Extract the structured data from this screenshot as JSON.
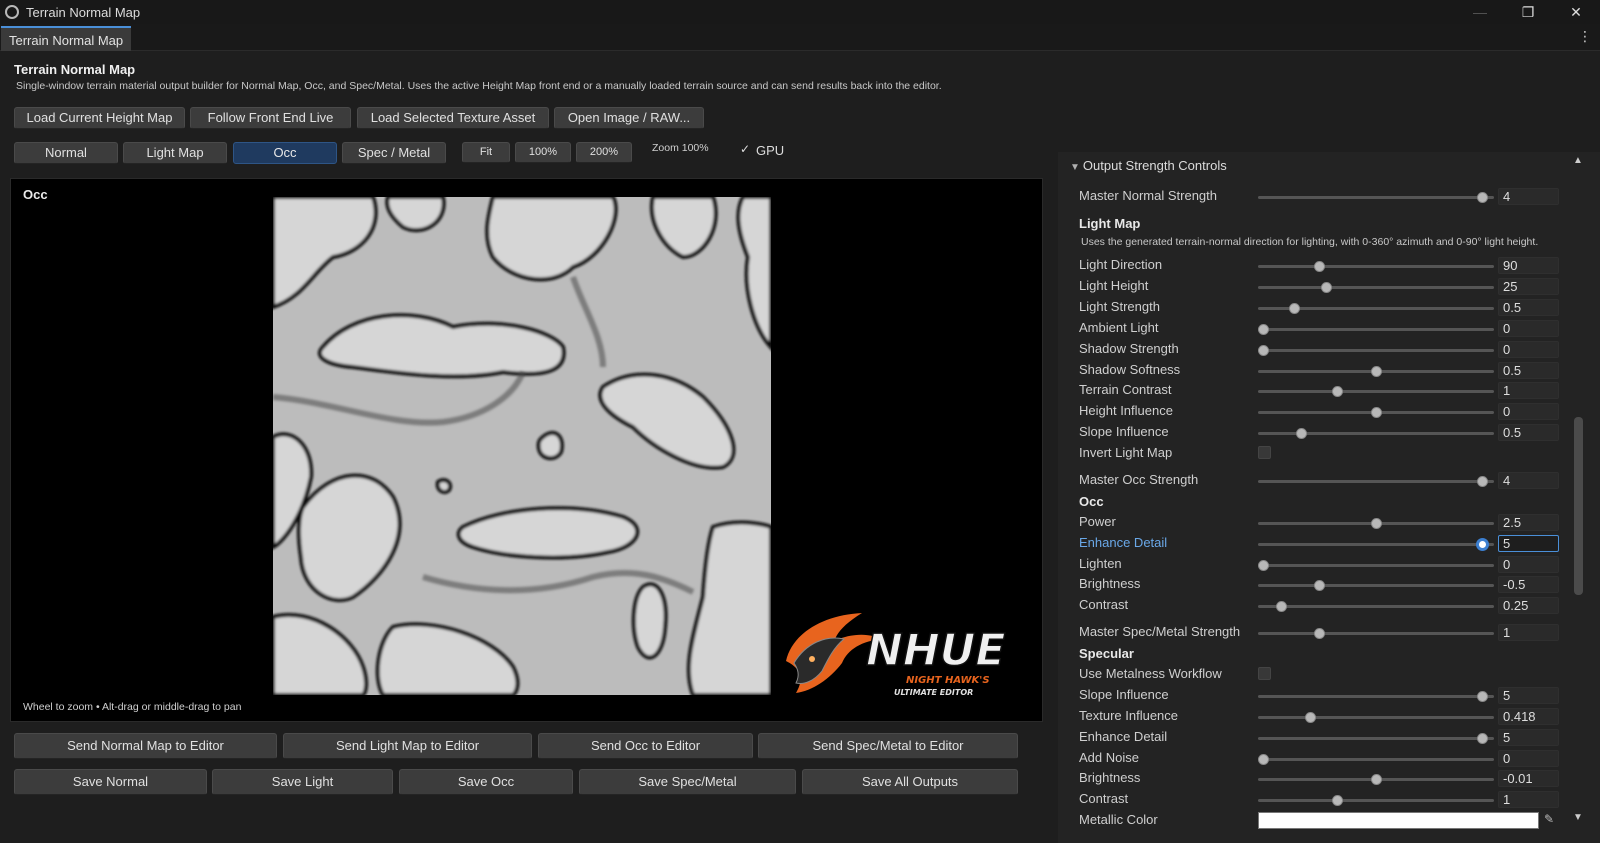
{
  "window": {
    "title": "Terrain Normal Map",
    "minimize": "—",
    "restore": "❐",
    "close": "✕",
    "icon": "gear-icon"
  },
  "tab": {
    "label": "Terrain Normal Map",
    "menu": "⋮"
  },
  "header": {
    "title": "Terrain Normal Map",
    "description": "Single-window terrain material output builder for Normal Map, Occ, and Spec/Metal. Uses the active Height Map front end or a manually loaded terrain source and can send results back into the editor."
  },
  "load_buttons": [
    "Load Current Height Map",
    "Follow Front End Live",
    "Load Selected Texture Asset",
    "Open Image / RAW..."
  ],
  "mode_buttons": [
    "Normal",
    "Light Map",
    "Occ",
    "Spec / Metal"
  ],
  "active_mode": "Occ",
  "zoom_buttons": [
    "Fit",
    "100%",
    "200%"
  ],
  "zoom_label": "Zoom 100%",
  "gpu": {
    "label": "GPU",
    "checked": true,
    "mark": "✓"
  },
  "viewport": {
    "label": "Occ",
    "hint": "Wheel to zoom • Alt-drag or middle-drag to pan"
  },
  "logo": {
    "brand": "NHUE",
    "line1": "NIGHT HAWK'S",
    "line2": "ULTIMATE EDITOR",
    "accent": "#e8641e"
  },
  "send_buttons": [
    "Send Normal Map to Editor",
    "Send Light Map to Editor",
    "Send Occ to Editor",
    "Send Spec/Metal to Editor"
  ],
  "save_buttons": [
    "Save Normal",
    "Save Light",
    "Save Occ",
    "Save Spec/Metal",
    "Save All Outputs"
  ],
  "panel": {
    "section_title": "Output Strength Controls",
    "master_normal": {
      "label": "Master Normal Strength",
      "value": "4",
      "fraction": 0.97
    },
    "light_map": {
      "title": "Light Map",
      "description": "Uses the generated terrain-normal direction for lighting, with 0-360° azimuth and 0-90° light height.",
      "rows": [
        {
          "label": "Light Direction",
          "value": "90",
          "fraction": 0.25
        },
        {
          "label": "Light Height",
          "value": "25",
          "fraction": 0.28
        },
        {
          "label": "Light Strength",
          "value": "0.5",
          "fraction": 0.14
        },
        {
          "label": "Ambient Light",
          "value": "0",
          "fraction": 0.0
        },
        {
          "label": "Shadow Strength",
          "value": "0",
          "fraction": 0.0
        },
        {
          "label": "Shadow Softness",
          "value": "0.5",
          "fraction": 0.5
        },
        {
          "label": "Terrain Contrast",
          "value": "1",
          "fraction": 0.33
        },
        {
          "label": "Height Influence",
          "value": "0",
          "fraction": 0.5
        },
        {
          "label": "Slope Influence",
          "value": "0.5",
          "fraction": 0.17
        }
      ],
      "invert_label": "Invert Light Map"
    },
    "master_occ": {
      "label": "Master Occ Strength",
      "value": "4",
      "fraction": 0.97
    },
    "occ": {
      "title": "Occ",
      "rows": [
        {
          "label": "Power",
          "value": "2.5",
          "fraction": 0.5
        },
        {
          "label": "Enhance Detail",
          "value": "5",
          "fraction": 0.97,
          "focused": true
        },
        {
          "label": "Lighten",
          "value": "0",
          "fraction": 0.0
        },
        {
          "label": "Brightness",
          "value": "-0.5",
          "fraction": 0.25
        },
        {
          "label": "Contrast",
          "value": "0.25",
          "fraction": 0.08
        }
      ]
    },
    "master_spec": {
      "label": "Master Spec/Metal Strength",
      "value": "1",
      "fraction": 0.25
    },
    "specular": {
      "title": "Specular",
      "metalness_label": "Use Metalness Workflow",
      "rows": [
        {
          "label": "Slope Influence",
          "value": "5",
          "fraction": 0.97
        },
        {
          "label": "Texture Influence",
          "value": "0.418",
          "fraction": 0.21
        },
        {
          "label": "Enhance Detail",
          "value": "5",
          "fraction": 0.97
        },
        {
          "label": "Add Noise",
          "value": "0",
          "fraction": 0.0
        },
        {
          "label": "Brightness",
          "value": "-0.01",
          "fraction": 0.5
        },
        {
          "label": "Contrast",
          "value": "1",
          "fraction": 0.33
        }
      ],
      "metallic_color_label": "Metallic Color",
      "metallic_color": "#ffffff"
    }
  }
}
